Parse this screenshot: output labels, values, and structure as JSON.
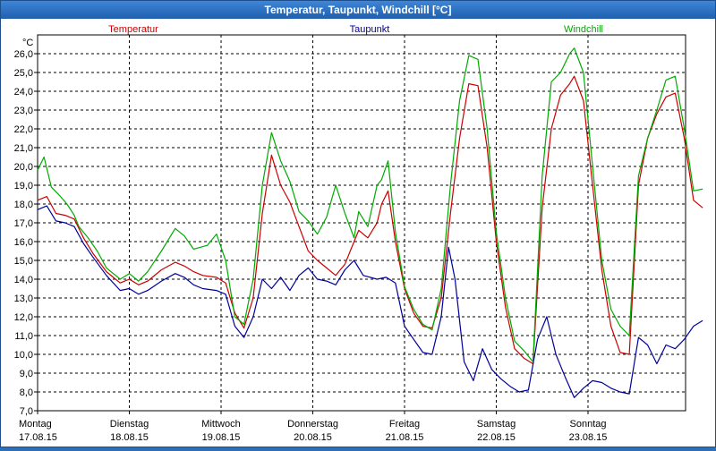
{
  "window": {
    "title": "Temperatur, Taupunkt, Windchill [°C]"
  },
  "chart_data": {
    "type": "line",
    "unit": "°C",
    "ylim": [
      7,
      27
    ],
    "yticks": [
      "7,0",
      "8,0",
      "9,0",
      "10,0",
      "11,0",
      "12,0",
      "13,0",
      "14,0",
      "15,0",
      "16,0",
      "17,0",
      "18,0",
      "19,0",
      "20,0",
      "21,0",
      "22,0",
      "23,0",
      "24,0",
      "25,0",
      "26,0"
    ],
    "days": [
      {
        "name": "Montag",
        "date": "17.08.15"
      },
      {
        "name": "Dienstag",
        "date": "18.08.15"
      },
      {
        "name": "Mittwoch",
        "date": "19.08.15"
      },
      {
        "name": "Donnerstag",
        "date": "20.08.15"
      },
      {
        "name": "Freitag",
        "date": "21.08.15"
      },
      {
        "name": "Samstag",
        "date": "22.08.15"
      },
      {
        "name": "Sonntag",
        "date": "23.08.15"
      }
    ],
    "grid": true,
    "series": [
      {
        "name": "Temperatur",
        "color": "#cc0000",
        "points": [
          [
            0,
            18.2
          ],
          [
            0.1,
            18.4
          ],
          [
            0.2,
            17.5
          ],
          [
            0.3,
            17.4
          ],
          [
            0.4,
            17.2
          ],
          [
            0.5,
            16.2
          ],
          [
            0.6,
            15.4
          ],
          [
            0.75,
            14.4
          ],
          [
            0.9,
            13.8
          ],
          [
            1.0,
            14.0
          ],
          [
            1.1,
            13.7
          ],
          [
            1.2,
            13.9
          ],
          [
            1.35,
            14.5
          ],
          [
            1.5,
            14.9
          ],
          [
            1.6,
            14.7
          ],
          [
            1.7,
            14.4
          ],
          [
            1.8,
            14.2
          ],
          [
            1.95,
            14.1
          ],
          [
            2.05,
            13.8
          ],
          [
            2.15,
            12.2
          ],
          [
            2.25,
            11.4
          ],
          [
            2.35,
            13.0
          ],
          [
            2.45,
            17.5
          ],
          [
            2.55,
            20.6
          ],
          [
            2.65,
            19.0
          ],
          [
            2.75,
            18.1
          ],
          [
            2.85,
            16.8
          ],
          [
            2.95,
            15.5
          ],
          [
            3.05,
            15.0
          ],
          [
            3.15,
            14.6
          ],
          [
            3.25,
            14.2
          ],
          [
            3.35,
            14.8
          ],
          [
            3.45,
            16.0
          ],
          [
            3.5,
            16.6
          ],
          [
            3.6,
            16.2
          ],
          [
            3.7,
            17.0
          ],
          [
            3.75,
            18.0
          ],
          [
            3.82,
            18.7
          ],
          [
            3.9,
            16.0
          ],
          [
            4.0,
            13.5
          ],
          [
            4.1,
            12.2
          ],
          [
            4.2,
            11.5
          ],
          [
            4.3,
            11.4
          ],
          [
            4.4,
            13.0
          ],
          [
            4.5,
            17.5
          ],
          [
            4.6,
            21.5
          ],
          [
            4.7,
            24.4
          ],
          [
            4.8,
            24.3
          ],
          [
            4.9,
            21.0
          ],
          [
            5.0,
            16.0
          ],
          [
            5.1,
            12.5
          ],
          [
            5.2,
            10.3
          ],
          [
            5.3,
            9.8
          ],
          [
            5.4,
            9.5
          ],
          [
            5.5,
            17.8
          ],
          [
            5.6,
            22.0
          ],
          [
            5.7,
            23.8
          ],
          [
            5.8,
            24.4
          ],
          [
            5.85,
            24.8
          ],
          [
            5.95,
            23.5
          ],
          [
            6.05,
            19.0
          ],
          [
            6.15,
            14.5
          ],
          [
            6.25,
            11.5
          ],
          [
            6.35,
            10.1
          ],
          [
            6.45,
            10.0
          ],
          [
            6.55,
            19.0
          ],
          [
            6.65,
            21.5
          ],
          [
            6.75,
            22.8
          ],
          [
            6.85,
            23.7
          ],
          [
            6.95,
            23.9
          ],
          [
            7.05,
            21.5
          ],
          [
            7.15,
            18.2
          ],
          [
            7.25,
            17.8
          ]
        ]
      },
      {
        "name": "Taupunkt",
        "color": "#00009c",
        "points": [
          [
            0,
            17.7
          ],
          [
            0.1,
            17.9
          ],
          [
            0.2,
            17.1
          ],
          [
            0.3,
            17.0
          ],
          [
            0.4,
            16.8
          ],
          [
            0.5,
            15.9
          ],
          [
            0.6,
            15.2
          ],
          [
            0.75,
            14.2
          ],
          [
            0.9,
            13.4
          ],
          [
            1.0,
            13.5
          ],
          [
            1.1,
            13.2
          ],
          [
            1.2,
            13.4
          ],
          [
            1.35,
            13.9
          ],
          [
            1.5,
            14.3
          ],
          [
            1.6,
            14.1
          ],
          [
            1.7,
            13.7
          ],
          [
            1.8,
            13.5
          ],
          [
            1.95,
            13.4
          ],
          [
            2.05,
            13.2
          ],
          [
            2.15,
            11.5
          ],
          [
            2.25,
            10.9
          ],
          [
            2.35,
            12.0
          ],
          [
            2.45,
            14.0
          ],
          [
            2.55,
            13.5
          ],
          [
            2.65,
            14.1
          ],
          [
            2.75,
            13.4
          ],
          [
            2.85,
            14.2
          ],
          [
            2.95,
            14.6
          ],
          [
            3.05,
            14.0
          ],
          [
            3.15,
            13.9
          ],
          [
            3.25,
            13.7
          ],
          [
            3.35,
            14.5
          ],
          [
            3.45,
            15.0
          ],
          [
            3.55,
            14.2
          ],
          [
            3.7,
            14.0
          ],
          [
            3.8,
            14.1
          ],
          [
            3.9,
            13.8
          ],
          [
            4.0,
            11.5
          ],
          [
            4.1,
            10.8
          ],
          [
            4.2,
            10.1
          ],
          [
            4.3,
            10.0
          ],
          [
            4.4,
            12.0
          ],
          [
            4.48,
            15.7
          ],
          [
            4.55,
            14.0
          ],
          [
            4.65,
            9.6
          ],
          [
            4.75,
            8.6
          ],
          [
            4.85,
            10.3
          ],
          [
            4.95,
            9.2
          ],
          [
            5.05,
            8.7
          ],
          [
            5.15,
            8.3
          ],
          [
            5.25,
            8.0
          ],
          [
            5.35,
            8.1
          ],
          [
            5.45,
            10.8
          ],
          [
            5.55,
            12.0
          ],
          [
            5.65,
            10.0
          ],
          [
            5.75,
            8.8
          ],
          [
            5.85,
            7.7
          ],
          [
            5.95,
            8.2
          ],
          [
            6.05,
            8.6
          ],
          [
            6.15,
            8.5
          ],
          [
            6.25,
            8.2
          ],
          [
            6.35,
            8.0
          ],
          [
            6.45,
            7.9
          ],
          [
            6.55,
            10.9
          ],
          [
            6.65,
            10.5
          ],
          [
            6.75,
            9.5
          ],
          [
            6.85,
            10.5
          ],
          [
            6.95,
            10.3
          ],
          [
            7.05,
            10.8
          ],
          [
            7.15,
            11.5
          ],
          [
            7.25,
            11.8
          ]
        ]
      },
      {
        "name": "Windchill",
        "color": "#00aa00",
        "points": [
          [
            0,
            19.8
          ],
          [
            0.07,
            20.5
          ],
          [
            0.15,
            18.9
          ],
          [
            0.25,
            18.4
          ],
          [
            0.32,
            18.0
          ],
          [
            0.4,
            17.4
          ],
          [
            0.45,
            16.8
          ],
          [
            0.55,
            16.2
          ],
          [
            0.65,
            15.5
          ],
          [
            0.75,
            14.6
          ],
          [
            0.9,
            14.0
          ],
          [
            1.0,
            14.3
          ],
          [
            1.1,
            13.9
          ],
          [
            1.2,
            14.4
          ],
          [
            1.35,
            15.5
          ],
          [
            1.5,
            16.7
          ],
          [
            1.6,
            16.3
          ],
          [
            1.7,
            15.6
          ],
          [
            1.85,
            15.8
          ],
          [
            1.95,
            16.4
          ],
          [
            2.05,
            15.0
          ],
          [
            2.15,
            12.0
          ],
          [
            2.25,
            11.6
          ],
          [
            2.35,
            14.0
          ],
          [
            2.45,
            19.0
          ],
          [
            2.55,
            21.8
          ],
          [
            2.65,
            20.3
          ],
          [
            2.75,
            19.2
          ],
          [
            2.85,
            17.6
          ],
          [
            2.95,
            17.1
          ],
          [
            3.05,
            16.4
          ],
          [
            3.15,
            17.3
          ],
          [
            3.25,
            19.0
          ],
          [
            3.35,
            17.5
          ],
          [
            3.45,
            16.2
          ],
          [
            3.5,
            17.6
          ],
          [
            3.6,
            16.8
          ],
          [
            3.7,
            19.0
          ],
          [
            3.75,
            19.3
          ],
          [
            3.82,
            20.3
          ],
          [
            3.9,
            16.5
          ],
          [
            4.0,
            13.6
          ],
          [
            4.1,
            12.4
          ],
          [
            4.2,
            11.6
          ],
          [
            4.3,
            11.3
          ],
          [
            4.4,
            13.5
          ],
          [
            4.5,
            19.0
          ],
          [
            4.6,
            23.5
          ],
          [
            4.7,
            25.9
          ],
          [
            4.8,
            25.7
          ],
          [
            4.9,
            22.0
          ],
          [
            5.0,
            16.5
          ],
          [
            5.1,
            13.0
          ],
          [
            5.2,
            10.7
          ],
          [
            5.3,
            10.2
          ],
          [
            5.4,
            9.6
          ],
          [
            5.5,
            19.5
          ],
          [
            5.6,
            24.5
          ],
          [
            5.7,
            25.0
          ],
          [
            5.8,
            26.0
          ],
          [
            5.85,
            26.3
          ],
          [
            5.95,
            25.0
          ],
          [
            6.05,
            20.0
          ],
          [
            6.15,
            15.0
          ],
          [
            6.25,
            12.4
          ],
          [
            6.35,
            11.5
          ],
          [
            6.45,
            11.0
          ],
          [
            6.55,
            19.5
          ],
          [
            6.65,
            21.5
          ],
          [
            6.75,
            23.0
          ],
          [
            6.85,
            24.6
          ],
          [
            6.95,
            24.8
          ],
          [
            7.05,
            22.0
          ],
          [
            7.15,
            18.7
          ],
          [
            7.25,
            18.8
          ]
        ]
      }
    ]
  }
}
